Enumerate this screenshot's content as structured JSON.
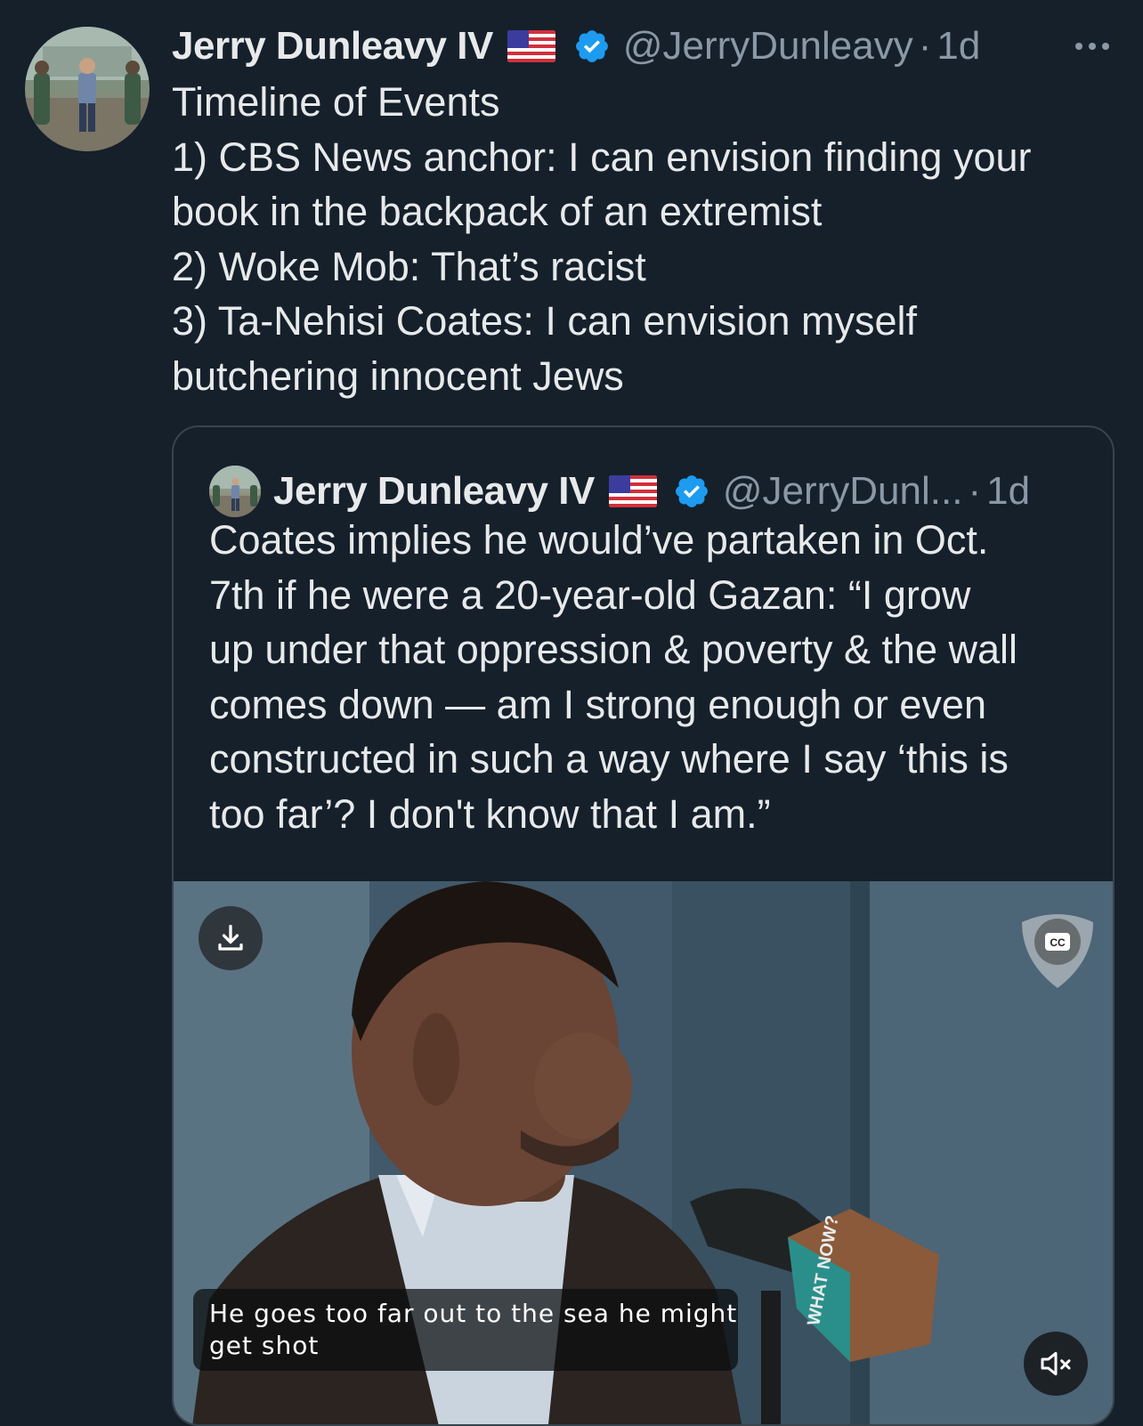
{
  "tweet": {
    "author_name": "Jerry Dunleavy IV",
    "handle": "@JerryDunleavy",
    "separator": "·",
    "time": "1d",
    "text_lines": [
      "Timeline of Events",
      "1) CBS News anchor: I can envision finding your",
      "book in the backpack of an extremist",
      "2) Woke Mob: That’s racist",
      "3) Ta-Nehisi Coates: I can envision myself",
      "butchering innocent Jews"
    ]
  },
  "quoted_tweet": {
    "author_name": "Jerry Dunleavy IV",
    "handle": "@JerryDunl...",
    "separator": "·",
    "time": "1d",
    "text_lines": [
      "Coates implies he would’ve partaken in Oct.",
      "7th if he were a 20-year-old Gazan: “I grow",
      "up under that oppression & poverty & the wall",
      "comes down — am I strong enough or even",
      "constructed in such a way where I say ‘this is",
      "too far’? I don't know that I am.”"
    ],
    "video": {
      "caption_lines": [
        "He goes too far out to the sea he might",
        "get shot"
      ],
      "cc_label": "CC",
      "mic_flag_text": "WHAT NOW?",
      "download_icon": "download-icon",
      "mute_icon": "volume-muted-icon"
    }
  },
  "colors": {
    "background": "#15202b",
    "text_primary": "#e7e9ea",
    "text_secondary": "#8b98a5",
    "verified_blue": "#1d9bf0",
    "border": "#38444d"
  }
}
